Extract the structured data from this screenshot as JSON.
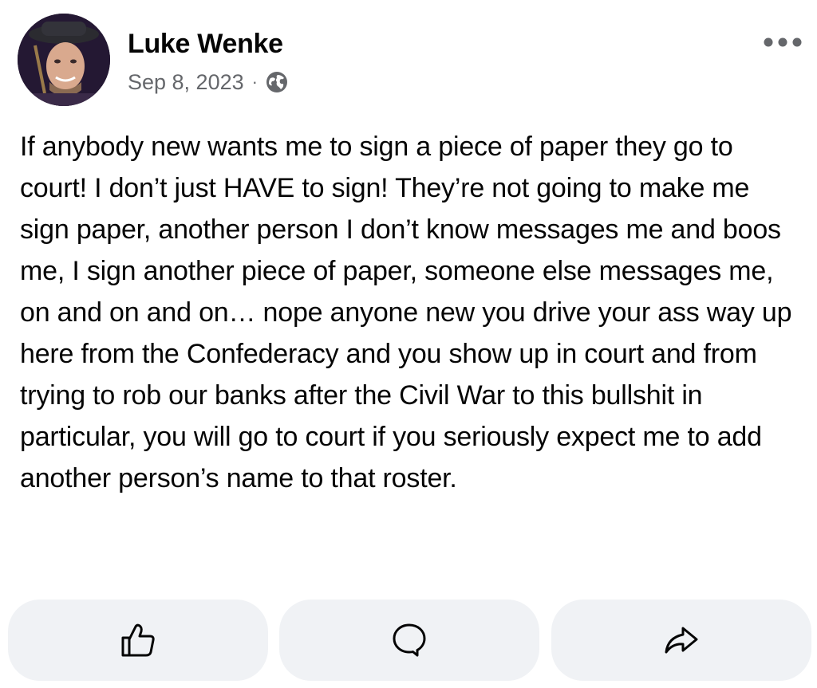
{
  "post": {
    "author": "Luke Wenke",
    "date": "Sep 8, 2023",
    "separator": "·",
    "audience_icon": "globe-icon",
    "body": "If anybody new wants me to sign a piece of paper they go to court!  I don’t just HAVE to sign!  They’re not going to make me sign paper, another person I don’t know messages me and boos me, I sign another piece of paper, someone else messages me, on and on and on… nope anyone new you drive your ass way up here from the Confederacy and you show up in court and from trying to rob our banks after the Civil War to this bullshit in particular, you will go to court if you seriously expect me to add another person’s name to that roster."
  },
  "header": {
    "more_icon": "more-options-icon"
  },
  "actions": {
    "like_icon": "thumbs-up-icon",
    "comment_icon": "comment-bubble-icon",
    "share_icon": "share-arrow-icon"
  },
  "colors": {
    "text_primary": "#050505",
    "text_secondary": "#65676b",
    "button_bg": "#f0f2f5"
  }
}
